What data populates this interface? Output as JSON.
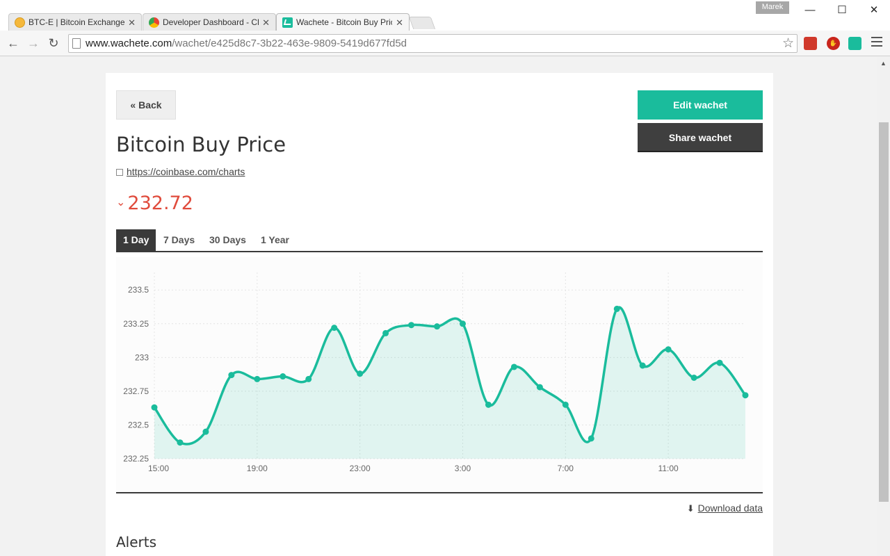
{
  "browser": {
    "tabs": [
      {
        "title": "BTC-E | Bitcoin Exchange,",
        "icon": "bitcoin-icon",
        "active": false
      },
      {
        "title": "Developer Dashboard - Cl",
        "icon": "chrome-webstore-icon",
        "active": false
      },
      {
        "title": "Wachete - Bitcoin Buy Pric",
        "icon": "wachete-icon",
        "active": true
      }
    ],
    "user": "Marek",
    "url_host": "www.wachete.com",
    "url_path": "/wachet/e425d8c7-3b22-463e-9809-5419d677fd5d",
    "window_controls": {
      "minimize": "—",
      "maximize": "☐",
      "close": "✕"
    }
  },
  "page": {
    "back_label": "« Back",
    "edit_label": "Edit wachet",
    "share_label": "Share wachet",
    "title": "Bitcoin Buy Price",
    "source_url": "https://coinbase.com/charts",
    "current_value": "232.72",
    "trend": "down",
    "range_tabs": [
      "1 Day",
      "7 Days",
      "30 Days",
      "1 Year"
    ],
    "active_range": "1 Day",
    "download_label": "Download data",
    "alerts_title": "Alerts"
  },
  "colors": {
    "accent": "#1abc9c",
    "negative": "#e04b3c",
    "dark": "#3a3a3a"
  },
  "chart_data": {
    "type": "area",
    "x": [
      "15:00",
      "16:00",
      "17:00",
      "18:00",
      "19:00",
      "20:00",
      "21:00",
      "22:00",
      "23:00",
      "0:00",
      "1:00",
      "2:00",
      "3:00",
      "4:00",
      "5:00",
      "6:00",
      "7:00",
      "8:00",
      "9:00",
      "10:00",
      "11:00",
      "12:00",
      "13:00",
      "14:00"
    ],
    "x_ticks": [
      "15:00",
      "19:00",
      "23:00",
      "3:00",
      "7:00",
      "11:00"
    ],
    "series": [
      {
        "values": [
          232.63,
          232.37,
          232.45,
          232.87,
          232.84,
          232.86,
          232.84,
          233.22,
          232.88,
          233.18,
          233.24,
          233.23,
          233.25,
          232.65,
          232.93,
          232.78,
          232.65,
          232.4,
          233.36,
          232.94,
          233.06,
          232.85,
          232.96,
          232.72
        ]
      }
    ],
    "y_ticks": [
      232.25,
      232.5,
      232.75,
      233,
      233.25,
      233.5
    ],
    "y_tick_labels": [
      "232.25",
      "232.5",
      "232.75",
      "233",
      "233.25",
      "233.5"
    ],
    "ylim": [
      232.25,
      233.63
    ],
    "grid": true,
    "color": "#1abc9c"
  }
}
